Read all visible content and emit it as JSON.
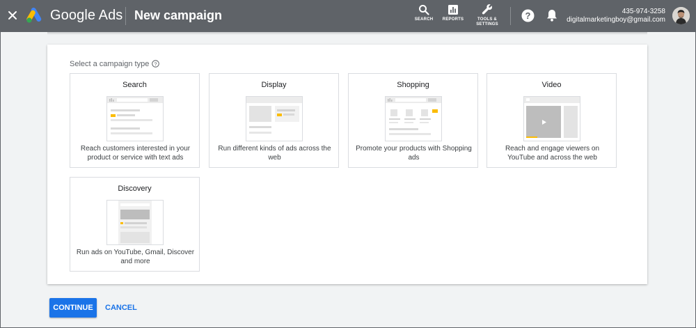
{
  "header": {
    "brand": "Google Ads",
    "title": "New campaign",
    "tools": {
      "search_label": "SEARCH",
      "reports_label": "REPORTS",
      "tools_label_line1": "TOOLS &",
      "tools_label_line2": "SETTINGS"
    },
    "account": {
      "phone": "435-974-3258",
      "email": "digitalmarketingboy@gmail.com"
    }
  },
  "main": {
    "section_label": "Select a campaign type",
    "campaign_types": [
      {
        "title": "Search",
        "description": "Reach customers interested in your product or service with text ads"
      },
      {
        "title": "Display",
        "description": "Run different kinds of ads across the web"
      },
      {
        "title": "Shopping",
        "description": "Promote your products with Shopping ads"
      },
      {
        "title": "Video",
        "description": "Reach and engage viewers on YouTube and across the web"
      },
      {
        "title": "Discovery",
        "description": "Run ads on YouTube, Gmail, Discover and more"
      }
    ]
  },
  "footer": {
    "continue_label": "CONTINUE",
    "cancel_label": "CANCEL"
  },
  "colors": {
    "header_bg": "#5f6368",
    "primary": "#1a73e8",
    "accent_yellow": "#fbbc04"
  }
}
